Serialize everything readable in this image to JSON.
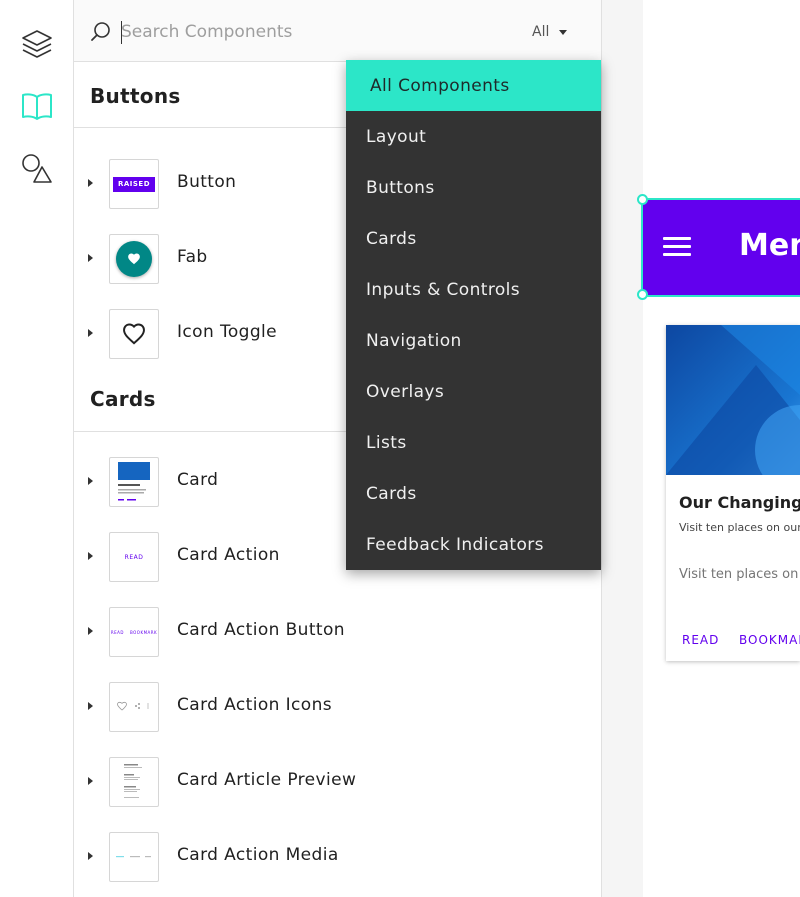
{
  "search": {
    "placeholder": "Search Components",
    "filter_label": "All"
  },
  "sections": [
    {
      "title": "Buttons",
      "items": [
        {
          "label": "Button",
          "thumb_text": "RAISED"
        },
        {
          "label": "Fab"
        },
        {
          "label": "Icon Toggle"
        }
      ]
    },
    {
      "title": "Cards",
      "items": [
        {
          "label": "Card"
        },
        {
          "label": "Card Action",
          "thumb_text": "READ"
        },
        {
          "label": "Card Action Button",
          "thumb_text_1": "READ",
          "thumb_text_2": "BOOKMARK"
        },
        {
          "label": "Card Action Icons"
        },
        {
          "label": "Card Article Preview"
        },
        {
          "label": "Card Action Media"
        }
      ]
    }
  ],
  "dropdown": {
    "items": [
      "All Components",
      "Layout",
      "Buttons",
      "Cards",
      "Inputs & Controls",
      "Navigation",
      "Overlays",
      "Lists",
      "Cards",
      "Feedback Indicators"
    ],
    "selected_index": 0
  },
  "preview": {
    "appbar_title": "Men",
    "card": {
      "title": "Our Changing P",
      "subtitle": "Visit ten places on our undergoing the biggest",
      "body": "Visit ten places on are undergoing the today.",
      "actions": [
        "READ",
        "BOOKMAR"
      ]
    }
  },
  "colors": {
    "accent": "#2ce6c8",
    "primary": "#6200ee",
    "fab": "#018786",
    "dropdown_bg": "#333333"
  }
}
